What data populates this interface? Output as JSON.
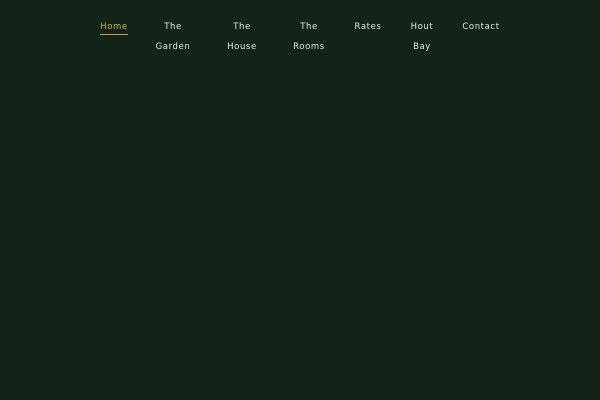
{
  "nav": {
    "home": "Home",
    "garden": [
      "The",
      "Garden"
    ],
    "house": [
      "The",
      "House"
    ],
    "rooms": [
      "The",
      "Rooms"
    ],
    "rates": "Rates",
    "hout_bay": [
      "Hout",
      "Bay"
    ],
    "contact": "Contact",
    "active": "Home"
  },
  "colors": {
    "background": "#132318",
    "nav_text": "#e6e6df",
    "active_text": "#c6b35c",
    "active_underline": "#b9a44f"
  }
}
